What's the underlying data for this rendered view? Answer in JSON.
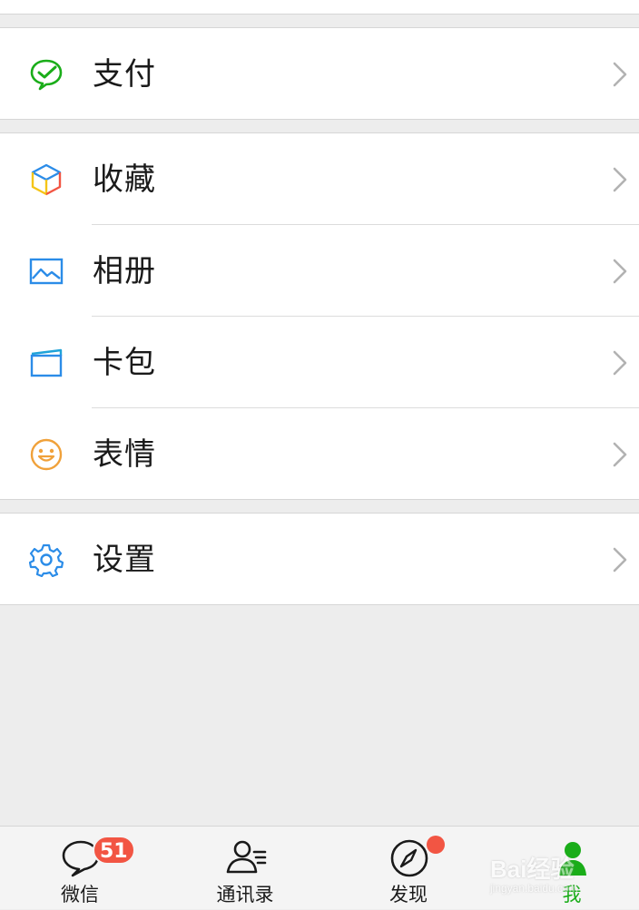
{
  "menu": {
    "pay": {
      "label": "支付",
      "icon": "wechat-pay-icon"
    },
    "favorites": {
      "label": "收藏",
      "icon": "cube-icon"
    },
    "album": {
      "label": "相册",
      "icon": "photo-icon"
    },
    "cards": {
      "label": "卡包",
      "icon": "card-wallet-icon"
    },
    "stickers": {
      "label": "表情",
      "icon": "smiley-icon"
    },
    "settings": {
      "label": "设置",
      "icon": "gear-icon"
    }
  },
  "tabbar": {
    "chats": {
      "label": "微信",
      "badge": "51",
      "icon": "chat-bubble-icon"
    },
    "contacts": {
      "label": "通讯录",
      "icon": "contacts-icon"
    },
    "discover": {
      "label": "发现",
      "icon": "compass-icon"
    },
    "me": {
      "label": "我",
      "icon": "person-icon"
    }
  },
  "watermark": {
    "text": "Bai经验",
    "sub": "jingyan.baidu.com"
  },
  "colors": {
    "accent": "#1aad19",
    "badge": "#f25543",
    "icon_blue": "#2b8ce8",
    "icon_orange": "#f0a13a",
    "background": "#ededed"
  }
}
